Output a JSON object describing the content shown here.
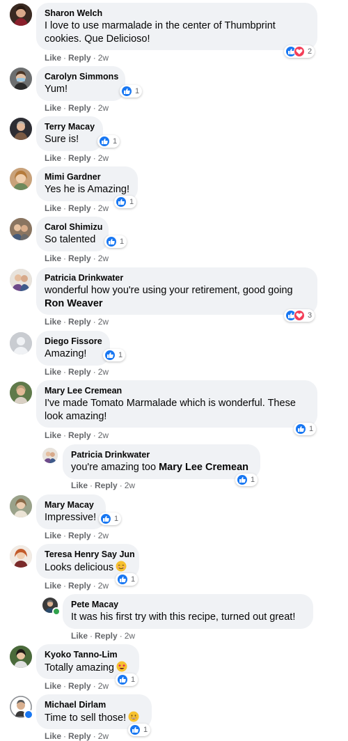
{
  "actions": {
    "like": "Like",
    "reply": "Reply",
    "dot": "·"
  },
  "colors": {
    "like_blue": "#1877f2",
    "love_red": "#f33e58",
    "bubble": "#f0f2f5",
    "meta_gray": "#65676b"
  },
  "comments": [
    {
      "name": "Sharon Welch",
      "text": "I love to use marmalade in the center of Thumbprint cookies. Que Delicioso!",
      "time": "2w",
      "count": "2",
      "reactions": [
        "like-icon",
        "love-icon"
      ]
    },
    {
      "name": "Carolyn Simmons",
      "text": "Yum!",
      "time": "2w",
      "count": "1",
      "reactions": [
        "like-icon"
      ]
    },
    {
      "name": "Terry Macay",
      "text": "Sure is!",
      "time": "2w",
      "count": "1",
      "reactions": [
        "like-icon"
      ]
    },
    {
      "name": "Mimi Gardner",
      "text": "Yes he is Amazing!",
      "time": "2w",
      "count": "1",
      "reactions": [
        "like-icon"
      ]
    },
    {
      "name": "Carol Shimizu",
      "text": "So talented",
      "time": "2w",
      "count": "1",
      "reactions": [
        "like-icon"
      ]
    },
    {
      "name": "Patricia Drinkwater",
      "text": "wonderful how you're using your retirement, good going",
      "mention": "Ron Weaver",
      "time": "2w",
      "count": "3",
      "reactions": [
        "like-icon",
        "love-icon"
      ]
    },
    {
      "name": "Diego Fissore",
      "text": "Amazing!",
      "time": "2w",
      "count": "1",
      "reactions": [
        "like-icon"
      ]
    },
    {
      "name": "Mary Lee Cremean",
      "text": "I've made Tomato Marmalade which is wonderful. These look amazing!",
      "time": "2w",
      "count": "1",
      "reactions": [
        "like-icon"
      ]
    },
    {
      "name": "Patricia Drinkwater",
      "text": "you're amazing too",
      "mention": "Mary Lee Cremean",
      "time": "2w",
      "count": "1",
      "reactions": [
        "like-icon"
      ]
    },
    {
      "name": "Mary Macay",
      "text": "Impressive!",
      "time": "2w",
      "count": "1",
      "reactions": [
        "like-icon"
      ]
    },
    {
      "name": "Teresa Henry Say Jun",
      "text": "Looks delicious",
      "emoji": "smiling-face-emoji",
      "time": "2w",
      "count": "1",
      "reactions": [
        "like-icon"
      ]
    },
    {
      "name": "Pete Macay",
      "text": "It was his first try with this recipe, turned out great!",
      "time": "2w"
    },
    {
      "name": "Kyoko Tanno-Lim",
      "text": "Totally amazing",
      "emoji": "star-struck-emoji",
      "time": "2w",
      "count": "1",
      "reactions": [
        "like-icon"
      ]
    },
    {
      "name": "Michael Dirlam",
      "text": "Time to sell those!",
      "emoji": "grinning-face-emoji",
      "time": "2w",
      "count": "1",
      "reactions": [
        "like-icon"
      ]
    }
  ]
}
